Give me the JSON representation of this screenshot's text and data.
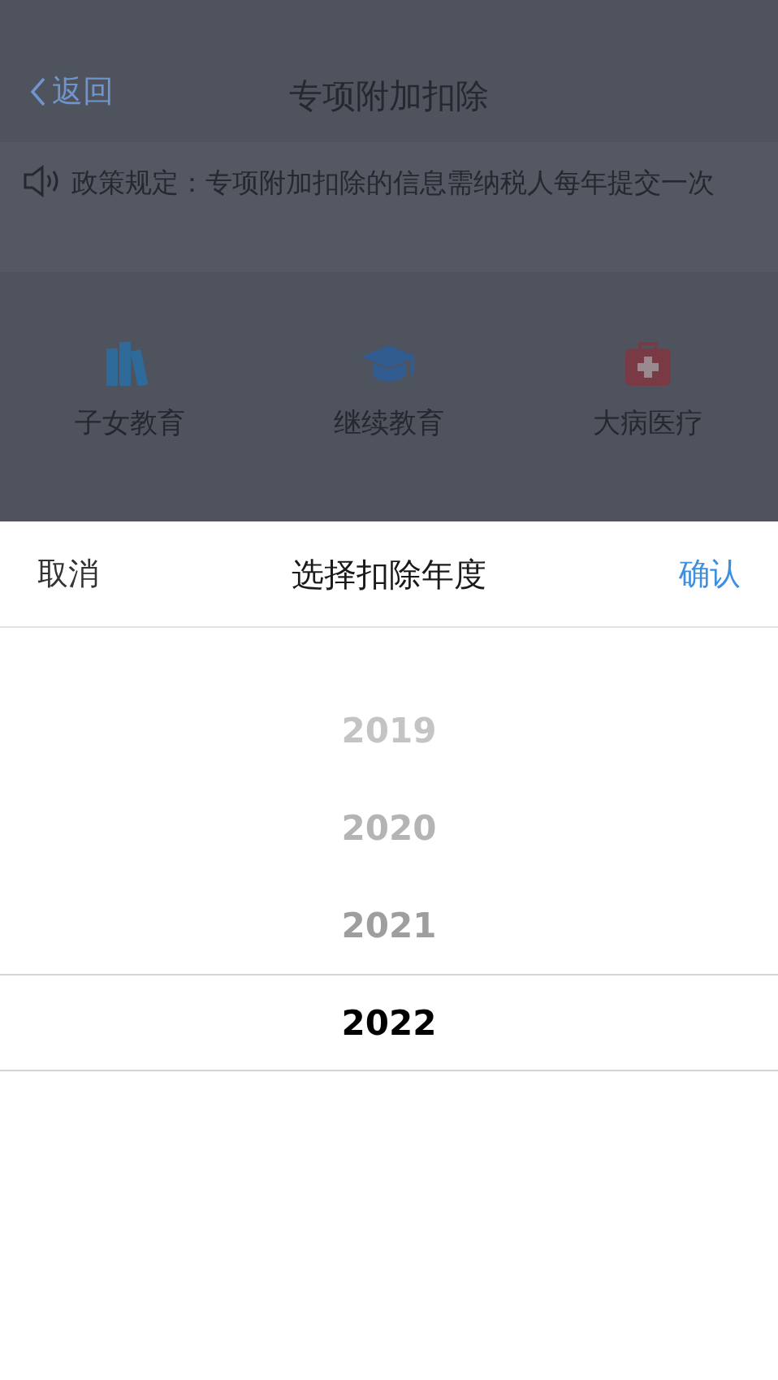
{
  "nav": {
    "back": "返回",
    "title": "专项附加扣除"
  },
  "notice": "政策规定：专项附加扣除的信息需纳税人每年提交一次",
  "categories": [
    {
      "kind": "books",
      "label": "子女教育"
    },
    {
      "kind": "cap",
      "label": "继续教育"
    },
    {
      "kind": "medkit",
      "label": "大病医疗"
    }
  ],
  "sheet": {
    "cancel": "取消",
    "title": "选择扣除年度",
    "confirm": "确认",
    "years": [
      {
        "label": "2019",
        "selected": false
      },
      {
        "label": "2020",
        "selected": false
      },
      {
        "label": "2021",
        "selected": false
      },
      {
        "label": "2022",
        "selected": true
      }
    ]
  }
}
